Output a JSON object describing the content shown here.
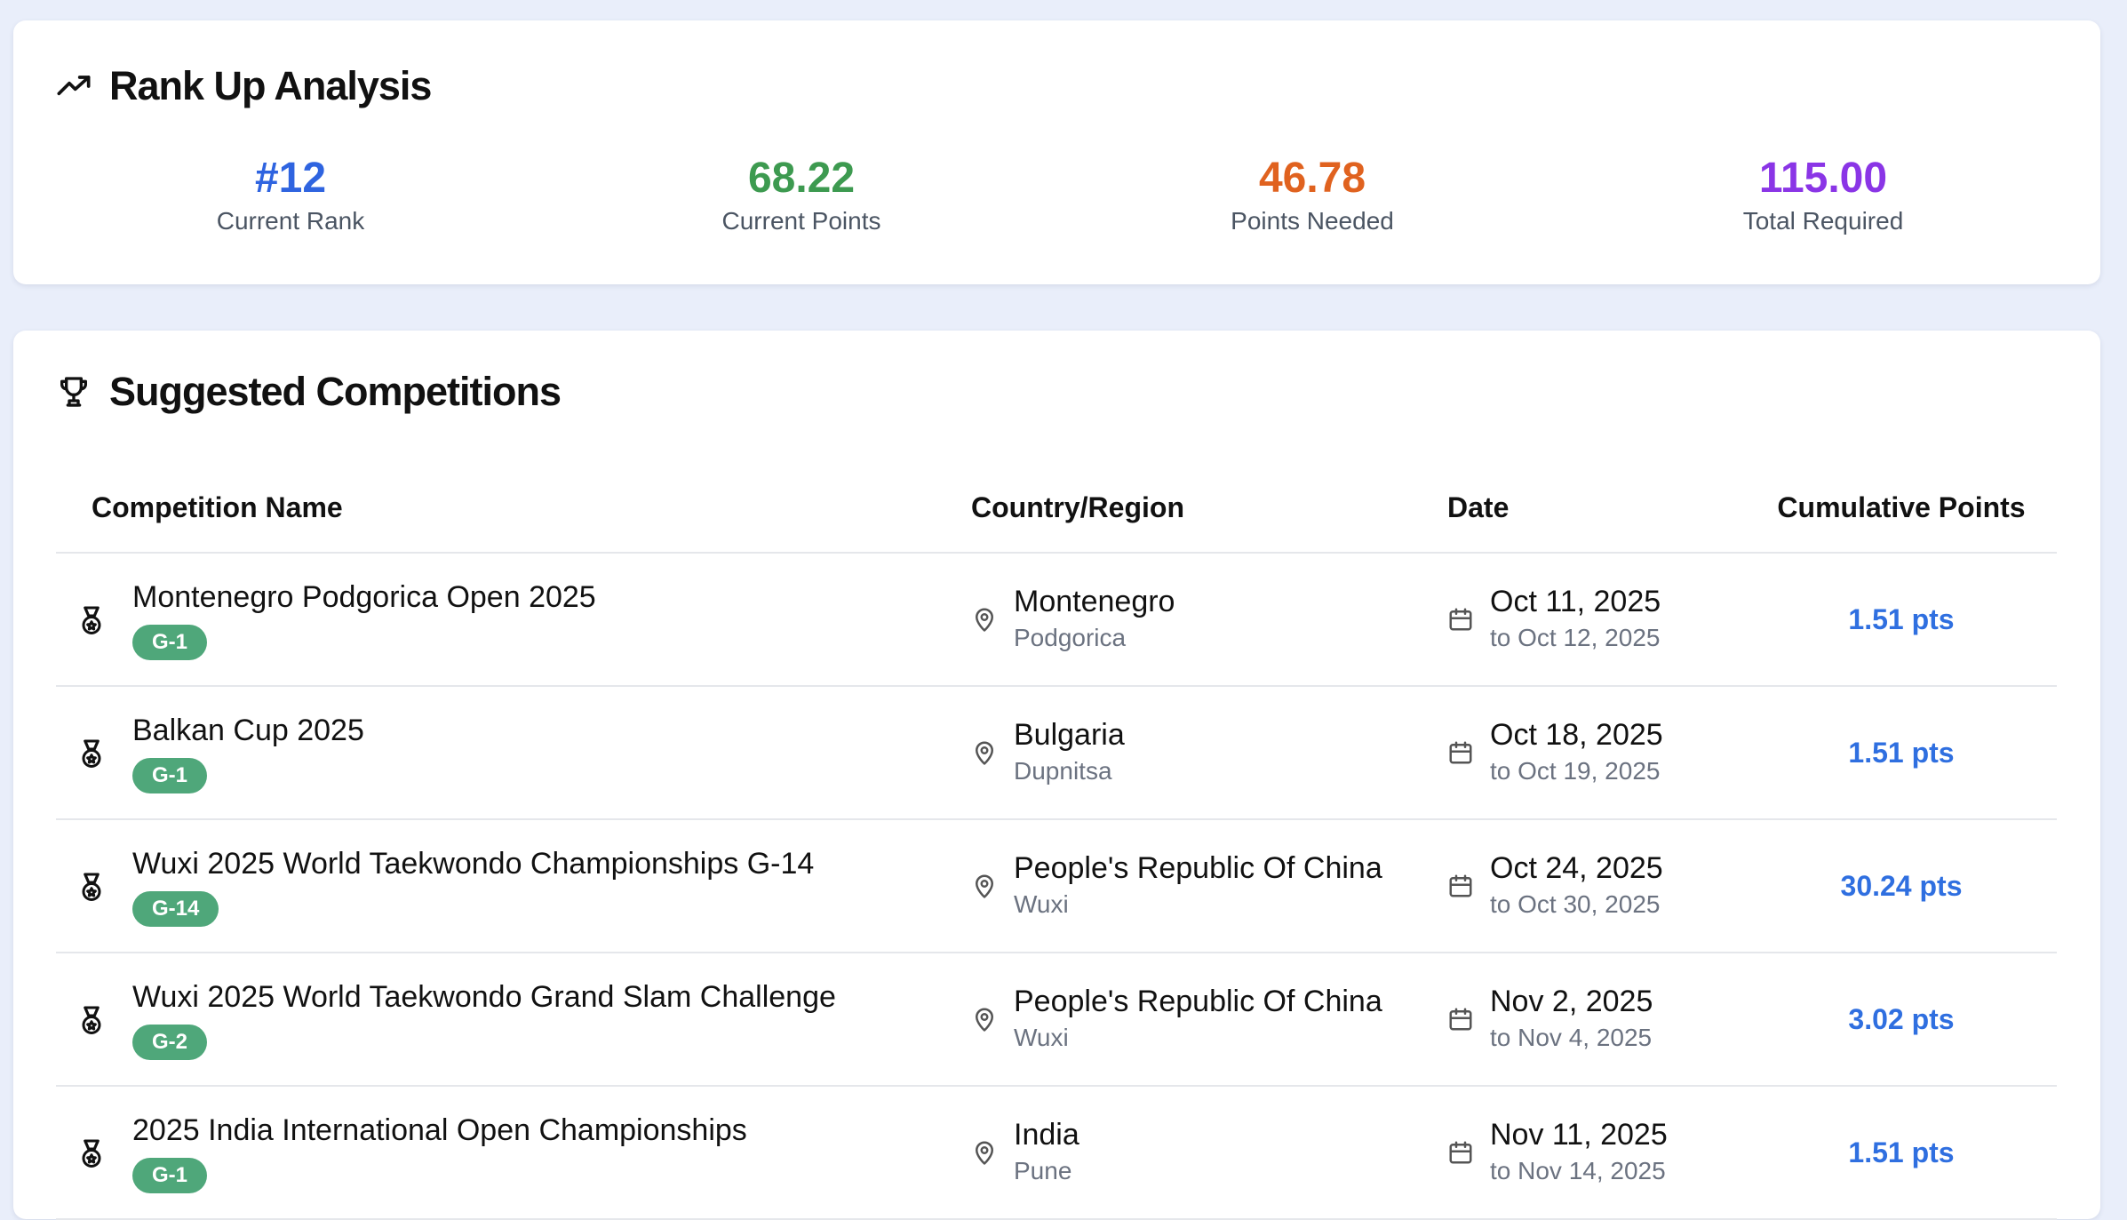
{
  "rank_up": {
    "title": "Rank Up Analysis",
    "stats": [
      {
        "value": "#12",
        "label": "Current Rank",
        "color": "#2f64e0"
      },
      {
        "value": "68.22",
        "label": "Current Points",
        "color": "#3d9a50"
      },
      {
        "value": "46.78",
        "label": "Points Needed",
        "color": "#e0621f"
      },
      {
        "value": "115.00",
        "label": "Total Required",
        "color": "#8a35e6"
      }
    ]
  },
  "competitions": {
    "title": "Suggested Competitions",
    "columns": [
      "Competition Name",
      "Country/Region",
      "Date",
      "Cumulative Points"
    ],
    "rows": [
      {
        "name": "Montenegro Podgorica Open 2025",
        "grade": "G-1",
        "country": "Montenegro",
        "city": "Podgorica",
        "start": "Oct 11, 2025",
        "end": "to Oct 12, 2025",
        "points": "1.51 pts"
      },
      {
        "name": "Balkan Cup 2025",
        "grade": "G-1",
        "country": "Bulgaria",
        "city": "Dupnitsa",
        "start": "Oct 18, 2025",
        "end": "to Oct 19, 2025",
        "points": "1.51 pts"
      },
      {
        "name": "Wuxi 2025 World Taekwondo Championships G-14",
        "grade": "G-14",
        "country": "People's Republic Of China",
        "city": "Wuxi",
        "start": "Oct 24, 2025",
        "end": "to Oct 30, 2025",
        "points": "30.24 pts"
      },
      {
        "name": "Wuxi 2025 World Taekwondo Grand Slam Challenge",
        "grade": "G-2",
        "country": "People's Republic Of China",
        "city": "Wuxi",
        "start": "Nov 2, 2025",
        "end": "to Nov 4, 2025",
        "points": "3.02 pts"
      },
      {
        "name": "2025 India International Open Championships",
        "grade": "G-1",
        "country": "India",
        "city": "Pune",
        "start": "Nov 11, 2025",
        "end": "to Nov 14, 2025",
        "points": "1.51 pts"
      }
    ]
  },
  "colors": {
    "background": "#e9eefa",
    "badge": "#4fa77a",
    "points": "#2f6fe0"
  }
}
